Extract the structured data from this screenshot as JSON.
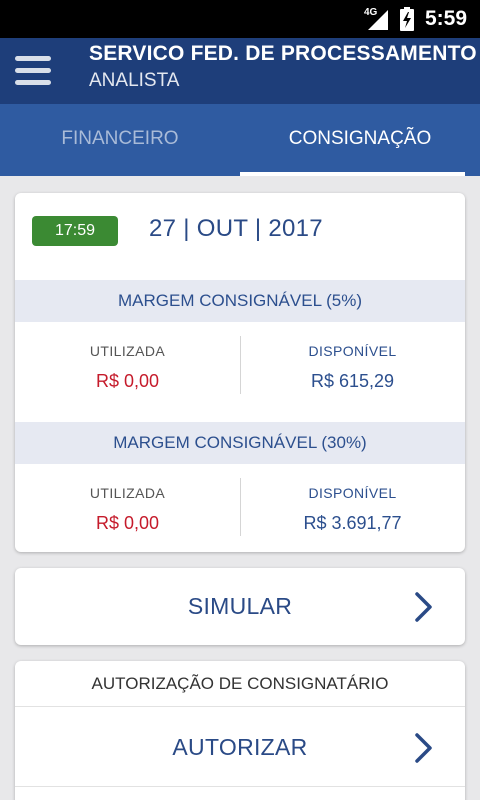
{
  "status_bar": {
    "network": "4G",
    "time": "5:59"
  },
  "app_bar": {
    "title": "SERVICO FED. DE PROCESSAMENTO",
    "subtitle": "ANALISTA"
  },
  "tabs": [
    {
      "label": "FINANCEIRO",
      "active": false
    },
    {
      "label": "CONSIGNAÇÃO",
      "active": true
    }
  ],
  "summary": {
    "time_badge": "17:59",
    "date": "27 | OUT | 2017",
    "margins": [
      {
        "title": "MARGEM CONSIGNÁVEL (5%)",
        "used_label": "UTILIZADA",
        "used_value": "R$ 0,00",
        "available_label": "DISPONÍVEL",
        "available_value": "R$ 615,29"
      },
      {
        "title": "MARGEM CONSIGNÁVEL (30%)",
        "used_label": "UTILIZADA",
        "used_value": "R$ 0,00",
        "available_label": "DISPONÍVEL",
        "available_value": "R$ 3.691,77"
      }
    ]
  },
  "simulate": {
    "label": "SIMULAR"
  },
  "authorization": {
    "header": "AUTORIZAÇÃO DE CONSIGNATÁRIO",
    "action_label": "AUTORIZAR"
  },
  "colors": {
    "app_bar": "#1e3e7a",
    "tabs": "#2f5ba1",
    "accent_text": "#2a4a86",
    "negative": "#c51b2b",
    "badge": "#3b8a33"
  }
}
